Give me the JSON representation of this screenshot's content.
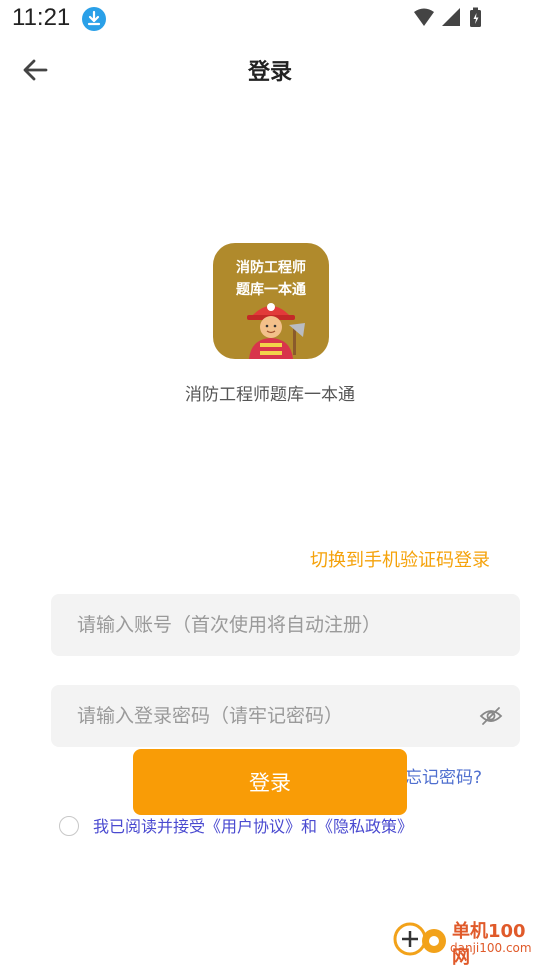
{
  "status_bar": {
    "time": "11:21",
    "icons": [
      "download-icon",
      "wifi-icon",
      "signal-icon",
      "battery-charging-icon"
    ]
  },
  "nav": {
    "title": "登录",
    "back_icon": "arrow-left-icon"
  },
  "app": {
    "logo_line1": "消防工程师",
    "logo_line2": "题库一本通",
    "name": "消防工程师题库一本通"
  },
  "login": {
    "switch_mode": "切换到手机验证码登录",
    "account_placeholder": "请输入账号（首次使用将自动注册）",
    "password_placeholder": "请输入登录密码（请牢记密码）",
    "forgot_password": "忘记密码?",
    "submit": "登录",
    "agreement": "我已阅读并接受《用户协议》和《隐私政策》"
  },
  "watermark": {
    "title": "单机100网",
    "url": "danji100.com"
  },
  "colors": {
    "accent": "#f99c06",
    "link": "#4f6fcf",
    "logo_bg": "#b08a2c"
  }
}
